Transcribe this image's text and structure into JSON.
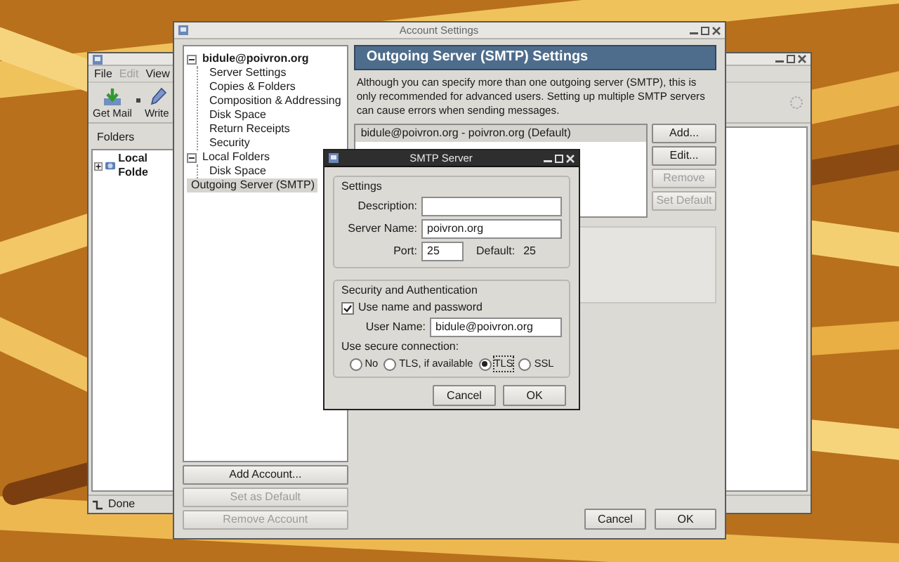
{
  "mail_window": {
    "menu": [
      {
        "label": "File",
        "disabled": false
      },
      {
        "label": "Edit",
        "disabled": true
      },
      {
        "label": "View",
        "disabled": false
      }
    ],
    "toolbar": [
      {
        "label": "Get Mail",
        "kind": "getmail"
      },
      {
        "label": "Write",
        "kind": "write"
      }
    ],
    "folders_header": "Folders",
    "folders": [
      {
        "label": "Local Folde",
        "expanded": false
      }
    ],
    "status": "Done"
  },
  "account_settings": {
    "title": "Account Settings",
    "tree": [
      {
        "label": "bidule@poivron.org",
        "default": true,
        "expanded": true,
        "selected": false,
        "children": [
          {
            "label": "Server Settings",
            "selected": false
          },
          {
            "label": "Copies & Folders",
            "selected": false
          },
          {
            "label": "Composition & Addressing",
            "selected": false
          },
          {
            "label": "Disk Space",
            "selected": false
          },
          {
            "label": "Return Receipts",
            "selected": false
          },
          {
            "label": "Security",
            "selected": false
          }
        ]
      },
      {
        "label": "Local Folders",
        "default": false,
        "expanded": true,
        "selected": false,
        "children": [
          {
            "label": "Disk Space",
            "selected": false
          }
        ]
      },
      {
        "label": "Outgoing Server (SMTP)",
        "default": false,
        "selected": true
      }
    ],
    "account_buttons": [
      {
        "label": "Add Account...",
        "disabled": false
      },
      {
        "label": "Set as Default",
        "disabled": true
      },
      {
        "label": "Remove Account",
        "disabled": true
      }
    ],
    "panel_title": "Outgoing Server (SMTP) Settings",
    "description": "Although you can specify more than one outgoing server (SMTP), this is only recommended for advanced users. Setting up multiple SMTP servers can cause errors when sending messages.",
    "servers": [
      {
        "label": "bidule@poivron.org - poivron.org (Default)",
        "selected": true
      }
    ],
    "server_buttons": [
      {
        "label": "Add...",
        "disabled": false
      },
      {
        "label": "Edit...",
        "disabled": false
      },
      {
        "label": "Remove",
        "disabled": true
      },
      {
        "label": "Set Default",
        "disabled": true
      }
    ],
    "buttons": [
      "Cancel",
      "OK"
    ]
  },
  "smtp_dialog": {
    "title": "SMTP Server",
    "settings": {
      "heading": "Settings",
      "description_label": "Description:",
      "server_label": "Server Name:",
      "server_value": "poivron.org",
      "port_label": "Port:",
      "port_value": "25",
      "default_label": "Default:",
      "default_value": "25"
    },
    "security": {
      "heading": "Security and Authentication",
      "use_name": {
        "label": "Use name and password",
        "checked": true
      },
      "user_label": "User Name:",
      "user_value": "bidule@poivron.org",
      "secure_label": "Use secure connection:",
      "options": [
        {
          "label": "No",
          "selected": false
        },
        {
          "label": "TLS, if available",
          "selected": false
        },
        {
          "label": "TLS",
          "selected": true
        },
        {
          "label": "SSL",
          "selected": false
        }
      ]
    },
    "buttons": [
      "Cancel",
      "OK"
    ]
  }
}
